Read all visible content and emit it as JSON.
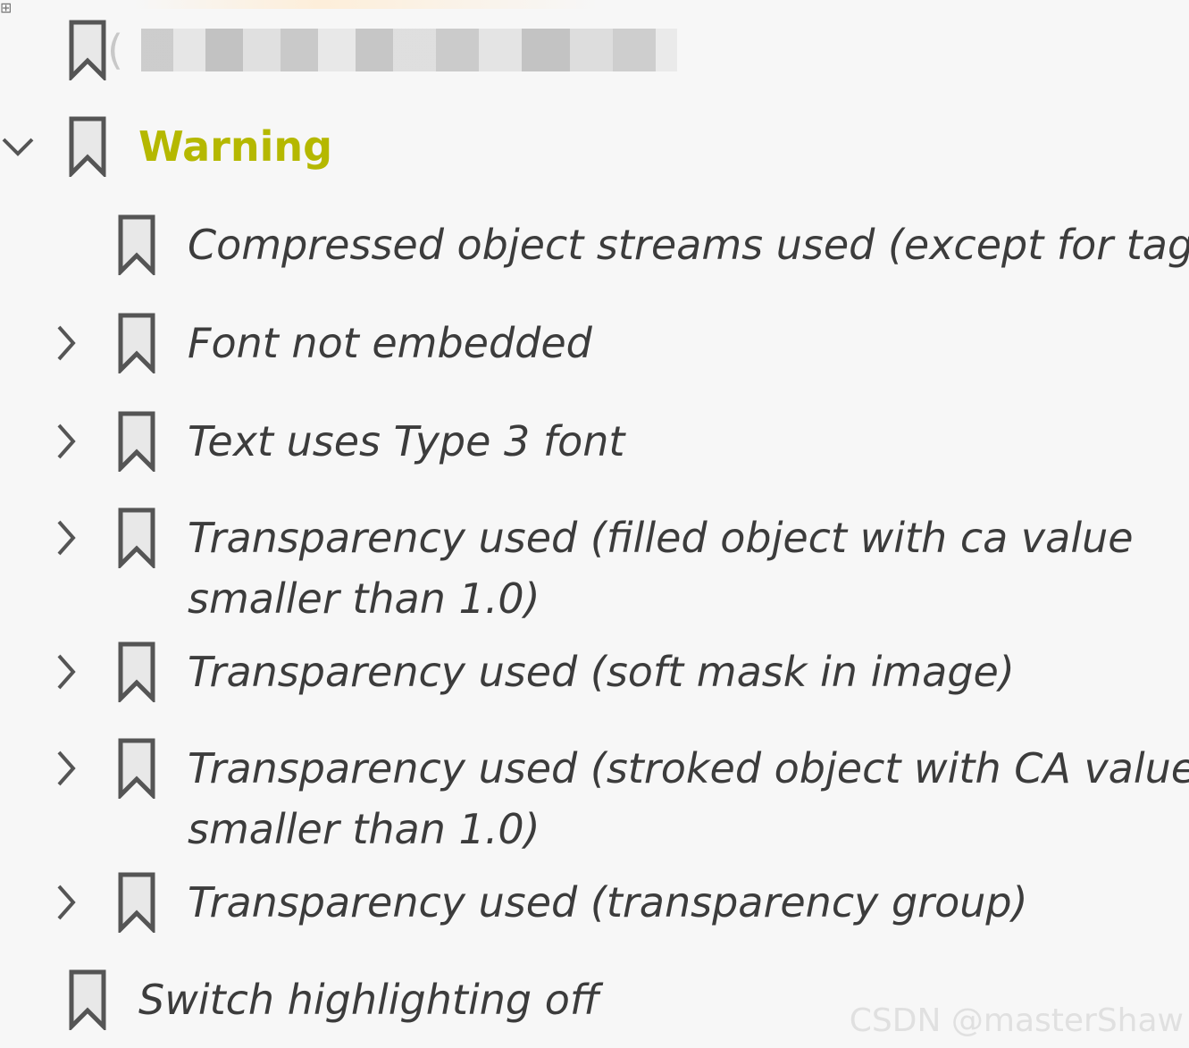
{
  "tree": {
    "items": [
      {
        "label": "",
        "redacted": true,
        "chevron": "none",
        "icon": "bookmark-icon"
      },
      {
        "label": "Warning",
        "chevron": "expanded",
        "icon": "bookmark-icon"
      },
      {
        "label": "Compressed object streams used (except for tags)",
        "chevron": "none",
        "icon": "bookmark-icon"
      },
      {
        "label": "Font not embedded",
        "chevron": "collapsed",
        "icon": "bookmark-icon"
      },
      {
        "label": "Text uses Type 3 font",
        "chevron": "collapsed",
        "icon": "bookmark-icon"
      },
      {
        "label_line1": "Transparency used (filled object with ca value",
        "label_line2": "smaller than 1.0)",
        "chevron": "collapsed",
        "icon": "bookmark-icon"
      },
      {
        "label": "Transparency used (soft mask in image)",
        "chevron": "collapsed",
        "icon": "bookmark-icon"
      },
      {
        "label_line1": "Transparency used (stroked object with CA value",
        "label_line2": "smaller than 1.0)",
        "chevron": "collapsed",
        "icon": "bookmark-icon"
      },
      {
        "label": "Transparency used (transparency group)",
        "chevron": "collapsed",
        "icon": "bookmark-icon"
      },
      {
        "label": "Switch highlighting off",
        "chevron": "none",
        "icon": "bookmark-icon"
      }
    ]
  },
  "colors": {
    "warning": "#b5b800",
    "text": "#3c3c3c",
    "icon": "#555555",
    "background": "#f7f7f7"
  },
  "watermark": "CSDN @masterShaw"
}
